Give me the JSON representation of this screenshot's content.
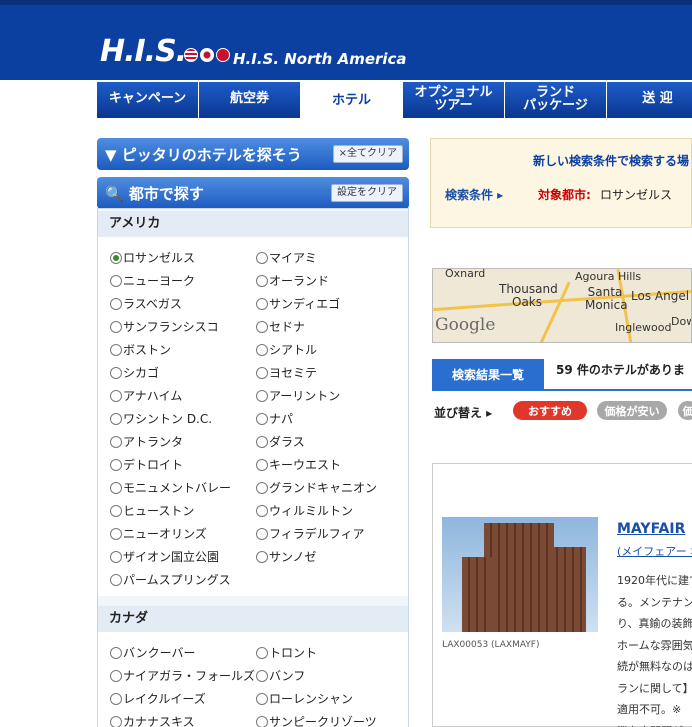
{
  "header": {
    "logo": "H.I.S.",
    "site_name": "H.I.S. North America"
  },
  "nav": {
    "tabs": [
      {
        "label": "キャンペーン"
      },
      {
        "label": "航空券"
      },
      {
        "label": "ホテル"
      },
      {
        "label": "オプショナル\nツアー"
      },
      {
        "label": "ランド\nパッケージ"
      },
      {
        "label": "送 迎"
      }
    ]
  },
  "finder": {
    "title": "▼ ピッタリのホテルを探そう",
    "clear_all": "×全てクリア"
  },
  "city_search": {
    "title": "🔍 都市で探す",
    "clear_settings": "設定をクリア"
  },
  "regions": [
    {
      "name": "アメリカ",
      "cities": [
        "ロサンゼルス",
        "マイアミ",
        "ニューヨーク",
        "オーランド",
        "ラスベガス",
        "サンディエゴ",
        "サンフランシスコ",
        "セドナ",
        "ボストン",
        "シアトル",
        "シカゴ",
        "ヨセミテ",
        "アナハイム",
        "アーリントン",
        "ワシントン D.C.",
        "ナパ",
        "アトランタ",
        "ダラス",
        "デトロイト",
        "キーウエスト",
        "モニュメントバレー",
        "グランドキャニオン",
        "ヒューストン",
        "ウィルミルトン",
        "ニューオリンズ",
        "フィラデルフィア",
        "ザイオン国立公園",
        "サンノゼ",
        "パームスプリングス"
      ],
      "selected": "ロサンゼルス"
    },
    {
      "name": "カナダ",
      "cities": [
        "バンクーバー",
        "トロント",
        "ナイアガラ・フォールズ",
        "バンフ",
        "レイクルイーズ",
        "ローレンシャン",
        "カナナスキス",
        "サンピークリゾーツ"
      ]
    }
  ],
  "search_conditions": {
    "new_search": "新しい検索条件で検索する場",
    "label": "検索条件 ▸",
    "city_label": "対象都市:",
    "city_value": "ロサンゼルス"
  },
  "map": {
    "labels": [
      "Oxnard",
      "Agoura Hills",
      "Thousand Oaks",
      "Santa Monica",
      "Los Angel",
      "Inglewood",
      "Dow"
    ],
    "logo": "Google"
  },
  "results": {
    "tab": "検索結果一覧",
    "count": "59 件のホテルがありま",
    "sort_label": "並び替え ▸",
    "sort_recommended": "おすすめ",
    "sort_price": "価格が安い",
    "sort_more": "価"
  },
  "hotel": {
    "code": "LAX00053 (LAXMAYF)",
    "name": "MAYFAIR",
    "kana": "(メイフェアー ホ",
    "description": [
      "1920年代に建て",
      "る。メンテナンス",
      "り、真鍮の装飾",
      "ホームな雰囲気",
      "続が無料なのは",
      "ランに関して】",
      "適用不可。※",
      "滞在中問題が"
    ]
  }
}
